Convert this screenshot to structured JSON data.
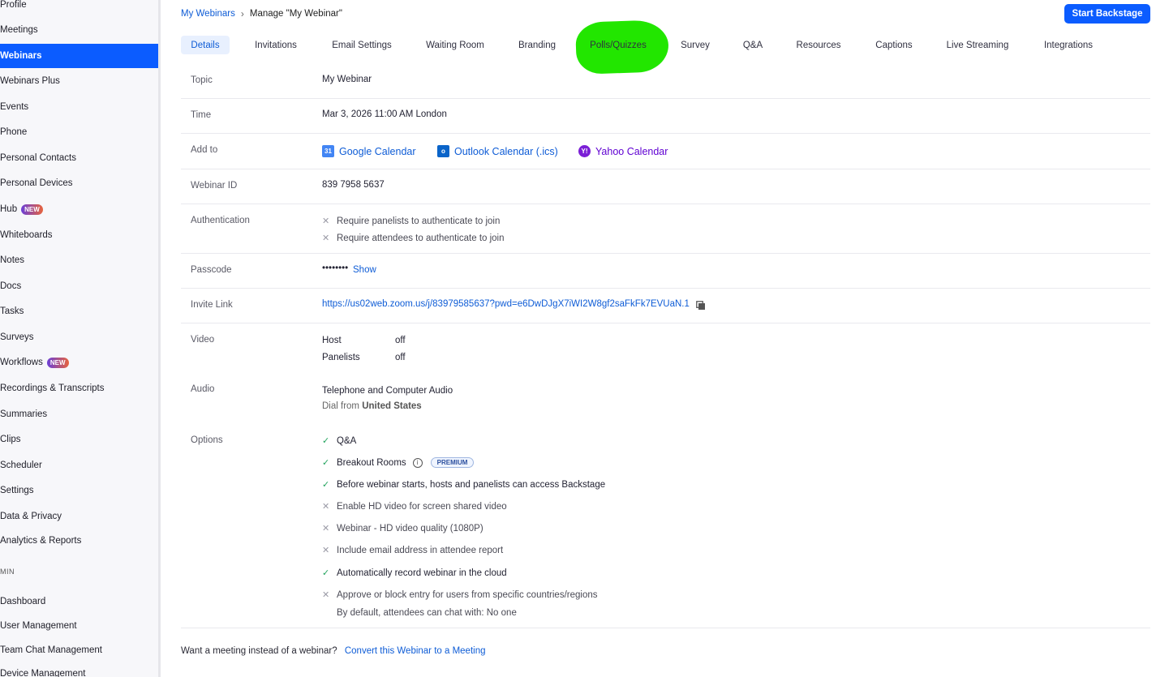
{
  "sidebar": {
    "items": [
      {
        "label": "Profile"
      },
      {
        "label": "Meetings"
      },
      {
        "label": "Webinars",
        "active": true
      },
      {
        "label": "Webinars Plus"
      },
      {
        "label": "Events"
      },
      {
        "label": "Phone"
      },
      {
        "label": "Personal Contacts"
      },
      {
        "label": "Personal Devices"
      },
      {
        "label": "Hub",
        "badge": "NEW"
      },
      {
        "label": "Whiteboards"
      },
      {
        "label": "Notes"
      },
      {
        "label": "Docs"
      },
      {
        "label": "Tasks"
      },
      {
        "label": "Surveys"
      },
      {
        "label": "Workflows",
        "badge": "NEW"
      },
      {
        "label": "Recordings & Transcripts"
      },
      {
        "label": "Summaries"
      },
      {
        "label": "Clips"
      },
      {
        "label": "Scheduler"
      },
      {
        "label": "Settings"
      },
      {
        "label": "Data & Privacy"
      },
      {
        "label": "Analytics & Reports"
      }
    ],
    "admin_section": "MIN",
    "admin_items": [
      {
        "label": "Dashboard"
      },
      {
        "label": "User Management"
      },
      {
        "label": "Team Chat Management"
      },
      {
        "label": "Device Management"
      }
    ]
  },
  "breadcrumb": {
    "parent": "My Webinars",
    "separator": "›",
    "current": "Manage \"My Webinar\""
  },
  "header": {
    "start_button": "Start Backstage"
  },
  "tabs": [
    {
      "label": "Details",
      "active": true
    },
    {
      "label": "Invitations"
    },
    {
      "label": "Email Settings"
    },
    {
      "label": "Waiting Room"
    },
    {
      "label": "Branding"
    },
    {
      "label": "Polls/Quizzes"
    },
    {
      "label": "Survey"
    },
    {
      "label": "Q&A"
    },
    {
      "label": "Resources"
    },
    {
      "label": "Captions"
    },
    {
      "label": "Live Streaming"
    },
    {
      "label": "Integrations"
    }
  ],
  "annotation": {
    "color": "#22e600"
  },
  "details": {
    "topic": {
      "label": "Topic",
      "value": "My Webinar"
    },
    "time": {
      "label": "Time",
      "value": "Mar 3, 2026 11:00 AM London"
    },
    "add_to": {
      "label": "Add to",
      "google": "Google Calendar",
      "google_icon": "31",
      "outlook": "Outlook Calendar (.ics)",
      "outlook_icon": "o",
      "yahoo": "Yahoo Calendar",
      "yahoo_icon": "Y!"
    },
    "webinar_id": {
      "label": "Webinar ID",
      "value": "839 7958 5637"
    },
    "authentication": {
      "label": "Authentication",
      "items": [
        "Require panelists to authenticate to join",
        "Require attendees to authenticate to join"
      ]
    },
    "passcode": {
      "label": "Passcode",
      "value": "••••••••",
      "show": "Show"
    },
    "invite_link": {
      "label": "Invite Link",
      "value": "https://us02web.zoom.us/j/83979585637?pwd=e6DwDJgX7iWI2W8gf2saFkFk7EVUaN.1"
    },
    "video": {
      "label": "Video",
      "host_label": "Host",
      "host_value": "off",
      "panelists_label": "Panelists",
      "panelists_value": "off"
    },
    "audio": {
      "label": "Audio",
      "value": "Telephone and Computer Audio",
      "dial_prefix": "Dial from",
      "dial_country": "United States"
    },
    "options": {
      "label": "Options",
      "items": [
        {
          "text": "Q&A",
          "enabled": true
        },
        {
          "text": "Breakout Rooms",
          "enabled": true,
          "info": "i",
          "badge": "PREMIUM"
        },
        {
          "text": "Before webinar starts, hosts and panelists can access Backstage",
          "enabled": true
        },
        {
          "text": "Enable HD video for screen shared video",
          "enabled": false
        },
        {
          "text": "Webinar - HD video quality (1080P)",
          "enabled": false
        },
        {
          "text": "Include email address in attendee report",
          "enabled": false
        },
        {
          "text": "Automatically record webinar in the cloud",
          "enabled": true
        },
        {
          "text": "Approve or block entry for users from specific countries/regions",
          "enabled": false
        }
      ],
      "chat_note": "By default, attendees can chat with: No one"
    }
  },
  "footer": {
    "question": "Want a meeting instead of a webinar?",
    "link": "Convert this Webinar to a Meeting"
  },
  "colors": {
    "accent": "#0b5cff",
    "link": "#0e5cd6",
    "check": "#22a45d",
    "yahoo": "#6001d2"
  }
}
